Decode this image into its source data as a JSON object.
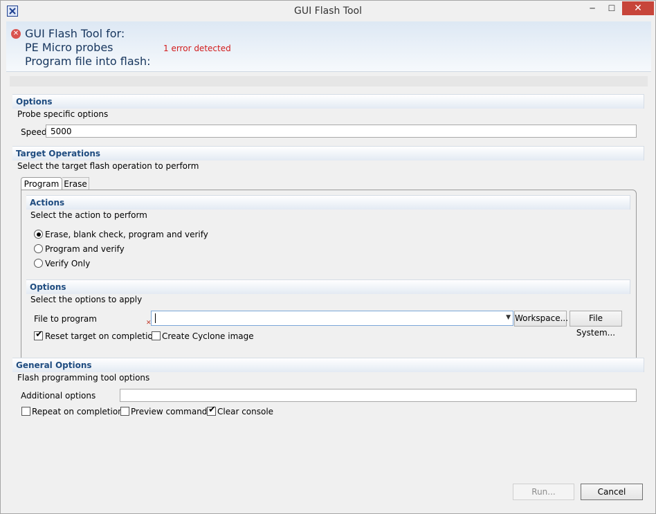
{
  "window": {
    "title": "GUI Flash Tool"
  },
  "header": {
    "line1": "GUI Flash Tool for:",
    "line2": "PE Micro probes",
    "line3": "Program file into flash:",
    "error": "1 error detected"
  },
  "options": {
    "title": "Options",
    "description": "Probe specific options",
    "speed_label": "Speed",
    "speed_value": "5000"
  },
  "target_operations": {
    "title": "Target Operations",
    "description": "Select the target flash operation to perform",
    "tabs": [
      "Program",
      "Erase"
    ],
    "actions": {
      "title": "Actions",
      "description": "Select the action to perform",
      "choices": [
        "Erase, blank check, program and verify",
        "Program and verify",
        "Verify Only"
      ],
      "selected": "Erase, blank check, program and verify"
    },
    "program_options": {
      "title": "Options",
      "description": "Select the options to apply",
      "file_label": "File to program",
      "file_value": "",
      "workspace_button": "Workspace...",
      "filesystem_button": "File System...",
      "reset_label": "Reset target on completion",
      "reset_checked": true,
      "cyclone_label": "Create Cyclone image",
      "cyclone_checked": false
    }
  },
  "general_options": {
    "title": "General Options",
    "description": "Flash programming tool options",
    "additional_label": "Additional options",
    "additional_value": "",
    "repeat_label": "Repeat on completion",
    "repeat_checked": false,
    "preview_label": "Preview command",
    "preview_checked": false,
    "clear_label": "Clear console",
    "clear_checked": true
  },
  "footer": {
    "run_label": "Run...",
    "cancel_label": "Cancel"
  },
  "colors": {
    "section_title": "#1f4c80",
    "error": "#d21b1b",
    "close_button": "#c7453a"
  }
}
